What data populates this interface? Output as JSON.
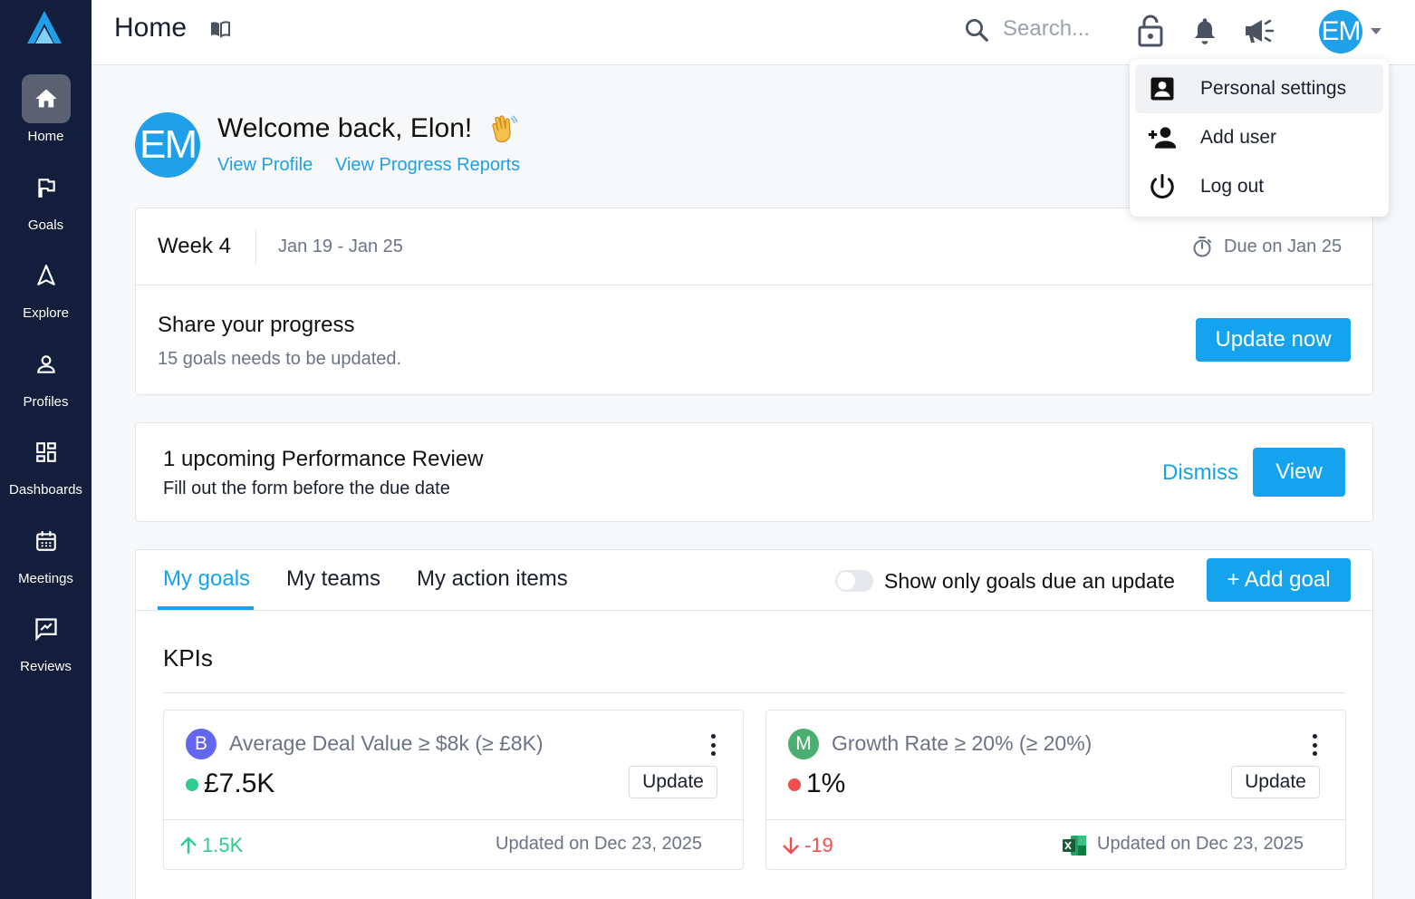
{
  "sidebar": {
    "items": [
      {
        "label": "Home",
        "icon": "home-icon"
      },
      {
        "label": "Goals",
        "icon": "flag-icon"
      },
      {
        "label": "Explore",
        "icon": "navigation-icon"
      },
      {
        "label": "Profiles",
        "icon": "person-icon"
      },
      {
        "label": "Dashboards",
        "icon": "dashboard-icon"
      },
      {
        "label": "Meetings",
        "icon": "calendar-icon"
      },
      {
        "label": "Reviews",
        "icon": "review-icon"
      }
    ]
  },
  "header": {
    "title": "Home",
    "search_placeholder": "Search...",
    "avatar_initials": "EM"
  },
  "user_menu": {
    "items": [
      {
        "label": "Personal settings",
        "icon": "account-box-icon"
      },
      {
        "label": "Add user",
        "icon": "person-add-icon"
      },
      {
        "label": "Log out",
        "icon": "power-icon"
      }
    ]
  },
  "welcome": {
    "avatar_initials": "EM",
    "title": "Welcome back, Elon!",
    "links": [
      "View Profile",
      "View Progress Reports"
    ]
  },
  "week": {
    "label": "Week 4",
    "dates": "Jan 19 - Jan 25",
    "due": "Due on Jan 25",
    "share_title": "Share your progress",
    "share_subtitle": "15 goals needs to be updated.",
    "update_button": "Update now"
  },
  "review": {
    "title": "1 upcoming Performance Review",
    "subtitle": "Fill out the form before the due date",
    "dismiss_button": "Dismiss",
    "view_button": "View"
  },
  "goals": {
    "tabs": [
      "My goals",
      "My teams",
      "My action items"
    ],
    "active_tab": "My goals",
    "toggle_label": "Show only goals due an update",
    "toggle_on": false,
    "add_button": "+ Add goal",
    "section_title": "KPIs",
    "kpis": [
      {
        "badge": "B",
        "badge_color": "#6366f1",
        "title": "Average Deal Value ≥ $8k  (≥ £8K)",
        "status_color": "#2ecc8f",
        "value": "£7.5K",
        "update_button": "Update",
        "change": "1.5K",
        "change_direction": "up",
        "change_color": "#2ecc8f",
        "updated": "Updated on Dec 23, 2025"
      },
      {
        "badge": "M",
        "badge_color": "#4caf72",
        "title": "Growth Rate ≥ 20%  (≥ 20%)",
        "status_color": "#f04e4e",
        "value": "1%",
        "update_button": "Update",
        "change": "-19",
        "change_direction": "down",
        "change_color": "#f04e4e",
        "updated": "Updated on Dec 23, 2025",
        "source_icon": "excel-icon"
      }
    ]
  },
  "colors": {
    "sidebar_bg": "#121e3b",
    "accent": "#14a3ec",
    "avatar_bg": "#1fa0e8"
  }
}
